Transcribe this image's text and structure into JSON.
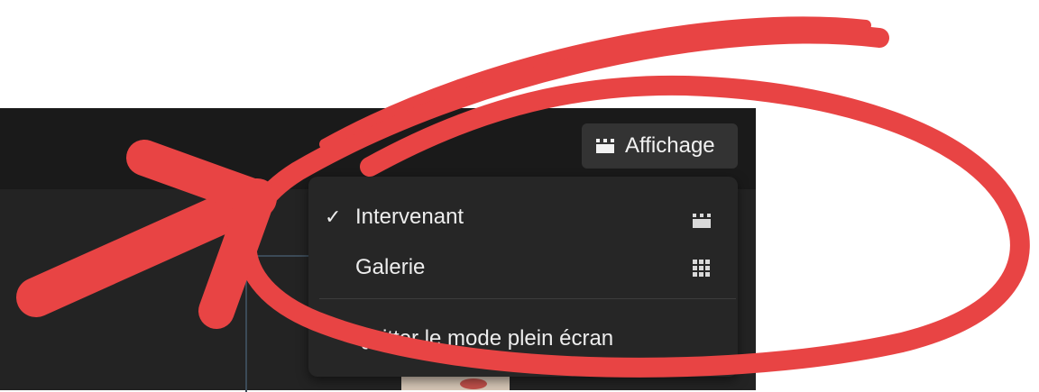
{
  "view_button": {
    "label": "Affichage",
    "icon": "speaker-view-icon"
  },
  "menu": {
    "items": [
      {
        "label": "Intervenant",
        "checked": true,
        "icon": "speaker-view-icon"
      },
      {
        "label": "Galerie",
        "checked": false,
        "icon": "gallery-grid-icon"
      }
    ],
    "fullscreen_label": "Quitter le mode plein écran",
    "check_glyph": "✓"
  },
  "annotation": {
    "color": "#e84444"
  }
}
